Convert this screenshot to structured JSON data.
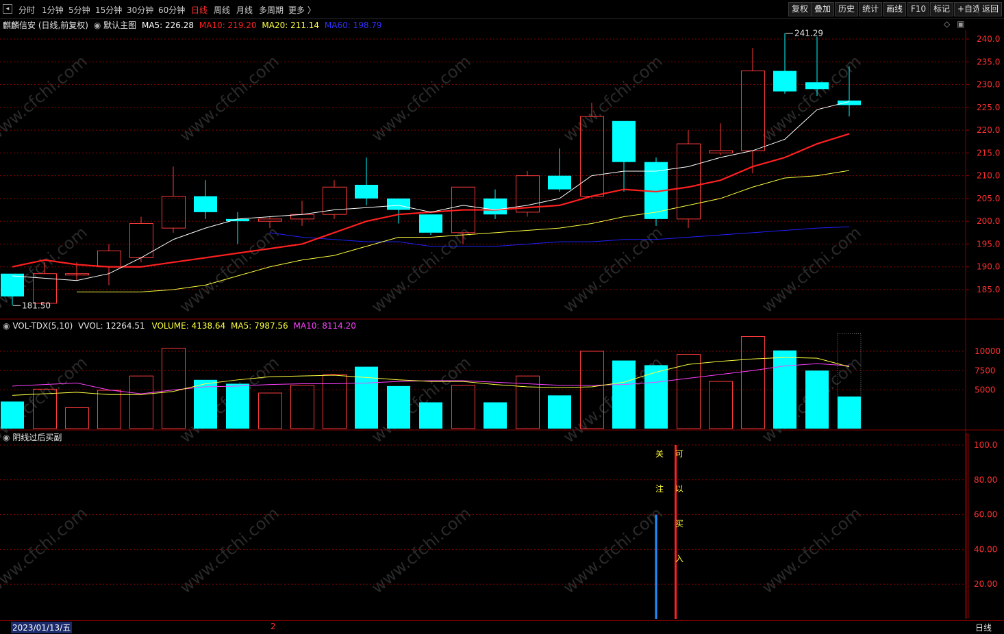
{
  "toolbar": {
    "periods": [
      "分时",
      "1分钟",
      "5分钟",
      "15分钟",
      "30分钟",
      "60分钟",
      "日线",
      "周线",
      "月线",
      "多周期",
      "更多 〉"
    ],
    "active_period": "日线",
    "right_buttons": [
      "复权",
      "叠加",
      "历史",
      "统计",
      "画线",
      "F10",
      "标记",
      "+自选",
      "返回"
    ]
  },
  "main_panel": {
    "stock_title": "麒麟信安 (日线,前复权)",
    "template_label": "默认主图",
    "ma5": "MA5: 226.28",
    "ma10": "MA10: 219.20",
    "ma20": "MA20: 211.14",
    "ma60": "MA60: 198.79",
    "high_label": "241.29",
    "low_label": "181.50",
    "price_ticks": [
      "240.0",
      "235.0",
      "230.0",
      "225.0",
      "220.0",
      "215.0",
      "210.0",
      "205.0",
      "200.0",
      "195.0",
      "190.0",
      "185.0"
    ]
  },
  "vol_panel": {
    "name": "VOL-TDX(5,10)",
    "vvol": "VVOL: 12264.51",
    "volume": "VOLUME: 4138.64",
    "ma5": "MA5: 7987.56",
    "ma10": "MA10: 8114.20",
    "ticks": [
      "10000",
      "7500",
      "5000"
    ]
  },
  "ind_panel": {
    "name": "阴线过后买副",
    "signal_watch": [
      "关",
      "注"
    ],
    "signal_buy": [
      "可",
      "以",
      "买",
      "入"
    ],
    "ticks": [
      "100.0",
      "80.00",
      "60.00",
      "40.00",
      "20.00"
    ]
  },
  "status_bar": {
    "date": "2023/01/13/五",
    "marker": "2",
    "period": "日线"
  },
  "watermark": "www.cfchi.com",
  "colors": {
    "up": "#ff3c3c",
    "down": "#00ffff",
    "ma5": "#ffffff",
    "ma10": "#ff2020",
    "ma20": "#ffff40",
    "ma60": "#2020ff",
    "vol_ma10": "#ff40ff",
    "grid": "#8b0000",
    "signal_watch": "#1e90ff",
    "signal_buy": "#ff2020",
    "text_yellow": "#ffff40"
  },
  "chart_data": {
    "type": "candlestick",
    "price_range": [
      181.5,
      241.29
    ],
    "candles": [
      {
        "o": 188.5,
        "h": 188.5,
        "l": 181.5,
        "c": 183.5
      },
      {
        "o": 182.0,
        "h": 191.0,
        "l": 182.0,
        "c": 188.5
      },
      {
        "o": 188.5,
        "h": 191.0,
        "l": 187.0,
        "c": 188.5
      },
      {
        "o": 190.0,
        "h": 195.0,
        "l": 186.0,
        "c": 193.5
      },
      {
        "o": 192.0,
        "h": 201.0,
        "l": 191.0,
        "c": 199.5
      },
      {
        "o": 198.5,
        "h": 212.0,
        "l": 197.5,
        "c": 205.5
      },
      {
        "o": 205.5,
        "h": 209.0,
        "l": 200.5,
        "c": 202.0
      },
      {
        "o": 200.5,
        "h": 202.0,
        "l": 195.0,
        "c": 200.0
      },
      {
        "o": 200.0,
        "h": 201.0,
        "l": 198.5,
        "c": 200.5
      },
      {
        "o": 200.5,
        "h": 204.5,
        "l": 199.0,
        "c": 201.5
      },
      {
        "o": 201.5,
        "h": 209.0,
        "l": 200.5,
        "c": 207.5
      },
      {
        "o": 208.0,
        "h": 214.0,
        "l": 203.5,
        "c": 205.0
      },
      {
        "o": 205.0,
        "h": 205.0,
        "l": 199.5,
        "c": 202.5
      },
      {
        "o": 201.5,
        "h": 201.5,
        "l": 197.0,
        "c": 197.5
      },
      {
        "o": 197.5,
        "h": 207.5,
        "l": 195.0,
        "c": 207.5
      },
      {
        "o": 205.0,
        "h": 207.0,
        "l": 200.5,
        "c": 201.5
      },
      {
        "o": 202.0,
        "h": 211.0,
        "l": 201.0,
        "c": 210.0
      },
      {
        "o": 210.0,
        "h": 216.0,
        "l": 206.5,
        "c": 207.0
      },
      {
        "o": 205.5,
        "h": 226.0,
        "l": 205.0,
        "c": 223.0
      },
      {
        "o": 222.0,
        "h": 222.0,
        "l": 206.5,
        "c": 213.0
      },
      {
        "o": 213.0,
        "h": 214.0,
        "l": 199.0,
        "c": 200.5
      },
      {
        "o": 200.5,
        "h": 220.0,
        "l": 198.5,
        "c": 217.0
      },
      {
        "o": 215.0,
        "h": 221.5,
        "l": 214.5,
        "c": 215.5
      },
      {
        "o": 215.5,
        "h": 238.0,
        "l": 210.5,
        "c": 233.0
      },
      {
        "o": 233.0,
        "h": 241.29,
        "l": 228.0,
        "c": 228.5
      },
      {
        "o": 230.5,
        "h": 240.5,
        "l": 227.5,
        "c": 229.0
      },
      {
        "o": 226.5,
        "h": 234.0,
        "l": 223.0,
        "c": 225.5
      }
    ],
    "ma5": [
      188.0,
      187.5,
      187.0,
      188.5,
      192.0,
      196.0,
      198.5,
      200.5,
      201.0,
      201.5,
      202.5,
      203.0,
      203.5,
      202.0,
      203.5,
      202.5,
      203.5,
      205.0,
      210.0,
      211.0,
      211.0,
      212.0,
      214.0,
      215.5,
      218.0,
      224.5,
      226.28
    ],
    "ma10": [
      190.0,
      191.5,
      190.5,
      190.0,
      190.0,
      191.0,
      192.0,
      193.0,
      194.0,
      195.0,
      197.5,
      200.0,
      201.5,
      202.0,
      202.5,
      202.5,
      203.0,
      203.5,
      205.5,
      207.0,
      206.5,
      207.5,
      209.0,
      212.0,
      214.0,
      217.0,
      219.2
    ],
    "ma20": [
      184.5,
      184.5,
      184.5,
      185.0,
      186.0,
      188.0,
      190.0,
      191.5,
      192.5,
      194.5,
      196.5,
      196.5,
      197.0,
      197.5,
      198.0,
      198.5,
      199.5,
      201.0,
      202.0,
      203.5,
      205.0,
      207.5,
      209.5,
      210.0,
      211.14
    ],
    "ma20_start": 2,
    "ma60": [
      197.5,
      196.5,
      196.0,
      195.5,
      195.5,
      194.5,
      194.5,
      194.5,
      195.0,
      195.5,
      195.5,
      196.0,
      196.0,
      196.5,
      197.0,
      197.5,
      198.0,
      198.5,
      198.79
    ],
    "ma60_start": 8,
    "volume": [
      3500,
      5100,
      2700,
      4950,
      6800,
      10400,
      6300,
      5800,
      4600,
      5600,
      7000,
      8000,
      5500,
      3400,
      5600,
      3400,
      6800,
      4300,
      10000,
      8800,
      8200,
      9600,
      6100,
      11900,
      10100,
      7500,
      4138.64
    ],
    "vol_ma5": [
      4300,
      4500,
      4700,
      4400,
      4400,
      4800,
      5800,
      6300,
      6700,
      6800,
      6900,
      6600,
      6300,
      6100,
      6100,
      5700,
      5400,
      5300,
      5400,
      6000,
      7300,
      8300,
      8700,
      9000,
      9200,
      9100,
      7987.56
    ],
    "vol_ma10": [
      5500,
      5700,
      5900,
      5000,
      4500,
      5000,
      5400,
      5500,
      5700,
      5800,
      5800,
      5900,
      6100,
      6200,
      6200,
      6000,
      5800,
      5600,
      5600,
      5700,
      6000,
      6500,
      7000,
      7500,
      8100,
      8400,
      8114.2
    ],
    "vol_range": [
      0,
      12264.51
    ],
    "indicator_range": [
      0,
      100
    ],
    "signal_watch_index": 20,
    "signal_watch_value": 60,
    "signal_buy_index": 21,
    "signal_buy_value": 100
  }
}
